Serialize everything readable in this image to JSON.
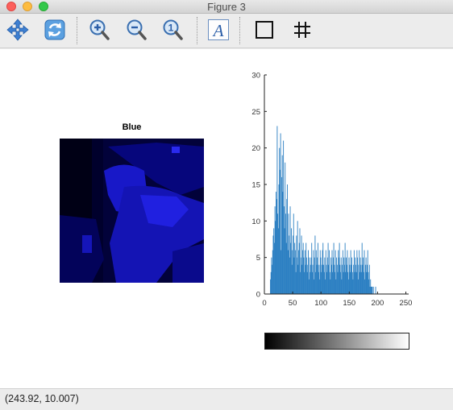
{
  "window": {
    "title": "Figure 3"
  },
  "toolbar": {
    "buttons": [
      {
        "name": "pan",
        "icon": "pan-arrows-icon"
      },
      {
        "name": "rotate",
        "icon": "rotate-icon"
      },
      {
        "name": "zoom-in",
        "icon": "zoom-in-icon"
      },
      {
        "name": "zoom-out",
        "icon": "zoom-out-icon"
      },
      {
        "name": "zoom-reset",
        "icon": "zoom-reset-icon",
        "label": "1"
      },
      {
        "name": "insert-text",
        "icon": "text-a-icon",
        "label": "A"
      },
      {
        "name": "axes-box",
        "icon": "box-icon"
      },
      {
        "name": "grid",
        "icon": "grid-icon"
      }
    ]
  },
  "image_panel": {
    "title": "Blue"
  },
  "chart_data": {
    "type": "bar",
    "title": "",
    "xlabel": "",
    "ylabel": "",
    "xlim": [
      0,
      255
    ],
    "ylim": [
      0,
      30
    ],
    "xticks": [
      0,
      50,
      100,
      150,
      200,
      250
    ],
    "yticks": [
      0,
      5,
      10,
      15,
      20,
      25,
      30
    ],
    "bar_color": "#2b7fc2",
    "x": [
      0,
      1,
      2,
      3,
      4,
      5,
      6,
      7,
      8,
      9,
      10,
      11,
      12,
      13,
      14,
      15,
      16,
      17,
      18,
      19,
      20,
      21,
      22,
      23,
      24,
      25,
      26,
      27,
      28,
      29,
      30,
      31,
      32,
      33,
      34,
      35,
      36,
      37,
      38,
      39,
      40,
      41,
      42,
      43,
      44,
      45,
      46,
      47,
      48,
      49,
      50,
      51,
      52,
      53,
      54,
      55,
      56,
      57,
      58,
      59,
      60,
      61,
      62,
      63,
      64,
      65,
      66,
      67,
      68,
      69,
      70,
      71,
      72,
      73,
      74,
      75,
      76,
      77,
      78,
      79,
      80,
      81,
      82,
      83,
      84,
      85,
      86,
      87,
      88,
      89,
      90,
      91,
      92,
      93,
      94,
      95,
      96,
      97,
      98,
      99,
      100,
      101,
      102,
      103,
      104,
      105,
      106,
      107,
      108,
      109,
      110,
      111,
      112,
      113,
      114,
      115,
      116,
      117,
      118,
      119,
      120,
      121,
      122,
      123,
      124,
      125,
      126,
      127,
      128,
      129,
      130,
      131,
      132,
      133,
      134,
      135,
      136,
      137,
      138,
      139,
      140,
      141,
      142,
      143,
      144,
      145,
      146,
      147,
      148,
      149,
      150,
      151,
      152,
      153,
      154,
      155,
      156,
      157,
      158,
      159,
      160,
      161,
      162,
      163,
      164,
      165,
      166,
      167,
      168,
      169,
      170,
      171,
      172,
      173,
      174,
      175,
      176,
      177,
      178,
      179,
      180,
      181,
      182,
      183,
      184,
      185,
      186,
      187,
      188,
      189,
      190,
      191,
      192,
      193,
      194,
      195,
      196,
      197,
      198,
      199,
      200
    ],
    "values": [
      0,
      0,
      0,
      0,
      0,
      0,
      0,
      0,
      0,
      0,
      2,
      3,
      5,
      4,
      6,
      8,
      9,
      7,
      12,
      10,
      14,
      13,
      23,
      11,
      9,
      15,
      20,
      17,
      22,
      6,
      16,
      19,
      14,
      21,
      12,
      9,
      18,
      11,
      7,
      13,
      15,
      6,
      11,
      8,
      5,
      12,
      7,
      9,
      4,
      6,
      8,
      11,
      5,
      7,
      6,
      3,
      8,
      5,
      10,
      4,
      6,
      7,
      9,
      3,
      5,
      8,
      4,
      6,
      7,
      5,
      3,
      6,
      4,
      7,
      5,
      3,
      4,
      6,
      2,
      5,
      3,
      4,
      5,
      7,
      3,
      4,
      6,
      2,
      5,
      8,
      3,
      6,
      4,
      5,
      7,
      3,
      4,
      2,
      6,
      5,
      3,
      4,
      6,
      7,
      4,
      3,
      5,
      2,
      6,
      4,
      3,
      5,
      7,
      4,
      6,
      3,
      2,
      5,
      4,
      6,
      3,
      5,
      7,
      4,
      3,
      6,
      2,
      5,
      4,
      3,
      6,
      5,
      7,
      4,
      3,
      5,
      2,
      4,
      6,
      3,
      5,
      4,
      7,
      3,
      5,
      4,
      6,
      3,
      2,
      5,
      4,
      3,
      6,
      4,
      5,
      3,
      2,
      4,
      6,
      3,
      5,
      4,
      3,
      6,
      5,
      2,
      4,
      6,
      3,
      5,
      4,
      3,
      7,
      4,
      5,
      3,
      6,
      2,
      4,
      5,
      3,
      4,
      6,
      3,
      2,
      4,
      1,
      2,
      1,
      1,
      1,
      0,
      1,
      0,
      0,
      0,
      1,
      0,
      0,
      0,
      0
    ],
    "colorbar": {
      "from": "#000000",
      "to": "#ffffff"
    }
  },
  "status": {
    "coords": "(243.92, 10.007)"
  }
}
